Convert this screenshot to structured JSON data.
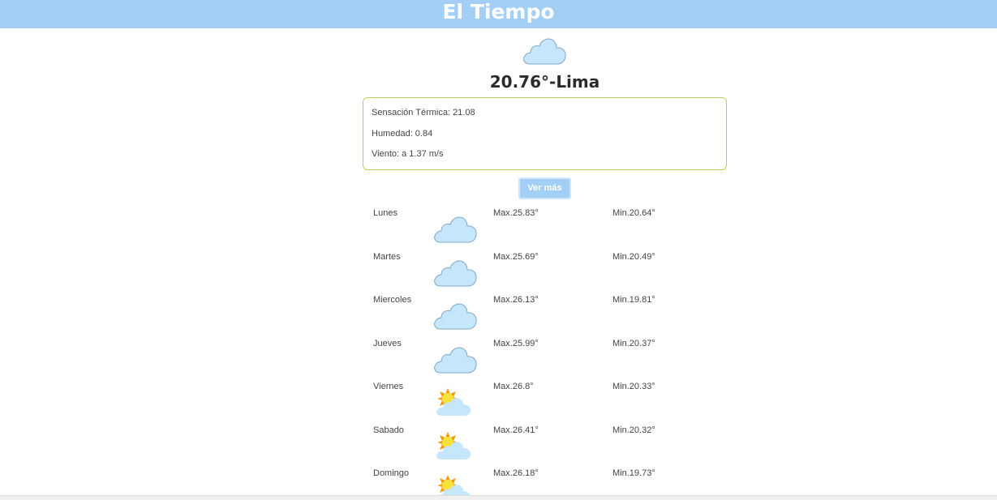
{
  "header": {
    "title": "El Tiempo"
  },
  "current": {
    "icon": "cloud-icon",
    "temperature": "20.76°",
    "separator": "-",
    "city": "Lima",
    "details": {
      "sensacion": "Sensación Térmica: 21.08",
      "humedad": "Humedad: 0.84",
      "viento": "Viento: a 1.37 m/s"
    }
  },
  "buttons": {
    "ver_mas": "Ver más"
  },
  "forecast": [
    {
      "day": "Lunes",
      "icon": "cloud-icon",
      "max": "Max.25.83°",
      "min": "Min.20.64°"
    },
    {
      "day": "Martes",
      "icon": "cloud-icon",
      "max": "Max.25.69°",
      "min": "Min.20.49°"
    },
    {
      "day": "Miercoles",
      "icon": "cloud-icon",
      "max": "Max.26.13°",
      "min": "Min.19.81°"
    },
    {
      "day": "Jueves",
      "icon": "cloud-icon",
      "max": "Max.25.99°",
      "min": "Min.20.37°"
    },
    {
      "day": "Viernes",
      "icon": "partly-cloudy-icon",
      "max": "Max.26.8°",
      "min": "Min.20.33°"
    },
    {
      "day": "Sabado",
      "icon": "partly-cloudy-icon",
      "max": "Max.26.41°",
      "min": "Min.20.32°"
    },
    {
      "day": "Domingo",
      "icon": "partly-cloudy-icon",
      "max": "Max.26.18°",
      "min": "Min.19.73°"
    }
  ],
  "colors": {
    "header_bg": "#a3cff7",
    "cloud_fill": "#c6e6fb",
    "cloud_stroke": "#7fa9c8",
    "details_border": "#b7d15c",
    "sun_outer": "#f39c12",
    "sun_inner": "#f7e23b"
  }
}
